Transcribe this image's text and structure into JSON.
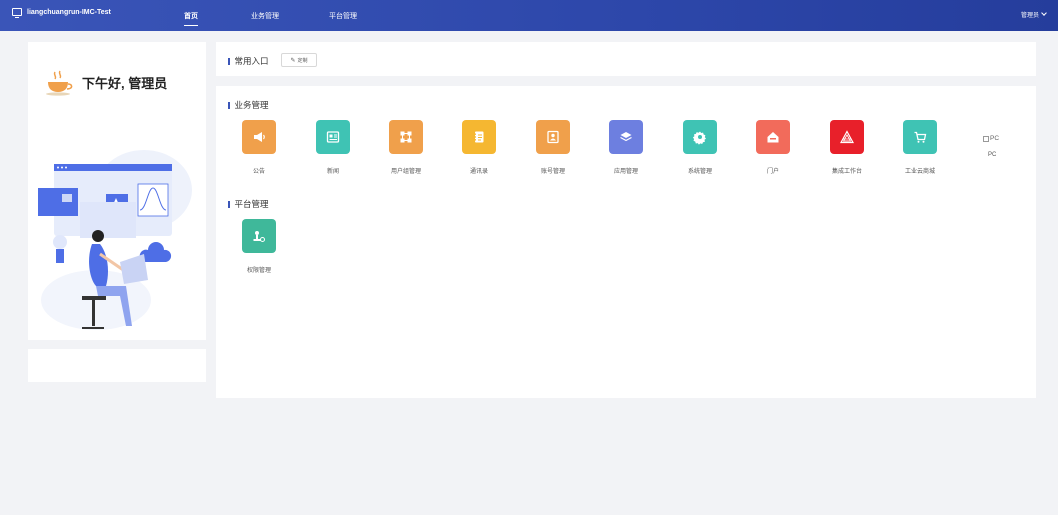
{
  "topbar": {
    "app_title": "liangchuangrun-IMC-Test",
    "nav": [
      {
        "label": "首页",
        "active": true
      },
      {
        "label": "业务管理",
        "active": false
      },
      {
        "label": "平台管理",
        "active": false
      }
    ],
    "user_label": "管理员"
  },
  "welcome": {
    "greeting": "下午好, 管理员"
  },
  "shortcuts": {
    "title": "常用入口",
    "edit_label": "定制"
  },
  "business": {
    "title": "业务管理",
    "apps": [
      {
        "label": "公告",
        "icon": "megaphone-icon",
        "color": "#f0a04b"
      },
      {
        "label": "新闻",
        "icon": "news-icon",
        "color": "#3fc3b4"
      },
      {
        "label": "用户组管理",
        "icon": "user-group-icon",
        "color": "#f0a04b"
      },
      {
        "label": "通讯录",
        "icon": "address-book-icon",
        "color": "#f5b731"
      },
      {
        "label": "账号管理",
        "icon": "account-icon",
        "color": "#f0a04b"
      },
      {
        "label": "应用管理",
        "icon": "layers-icon",
        "color": "#6d7fe0"
      },
      {
        "label": "系统管理",
        "icon": "gear-icon",
        "color": "#3fc3b4"
      },
      {
        "label": "门户",
        "icon": "home-icon",
        "color": "#f26b5b"
      },
      {
        "label": "集成工作台",
        "icon": "triangle-logo-icon",
        "color": "#e8202a"
      },
      {
        "label": "工业云商城",
        "icon": "cart-icon",
        "color": "#3fc3b4"
      }
    ],
    "broken_image_alt": "PC",
    "pc_label": "PC"
  },
  "platform": {
    "title": "平台管理",
    "apps": [
      {
        "label": "权限管理",
        "icon": "permission-icon",
        "color": "#3fb89a"
      }
    ]
  }
}
